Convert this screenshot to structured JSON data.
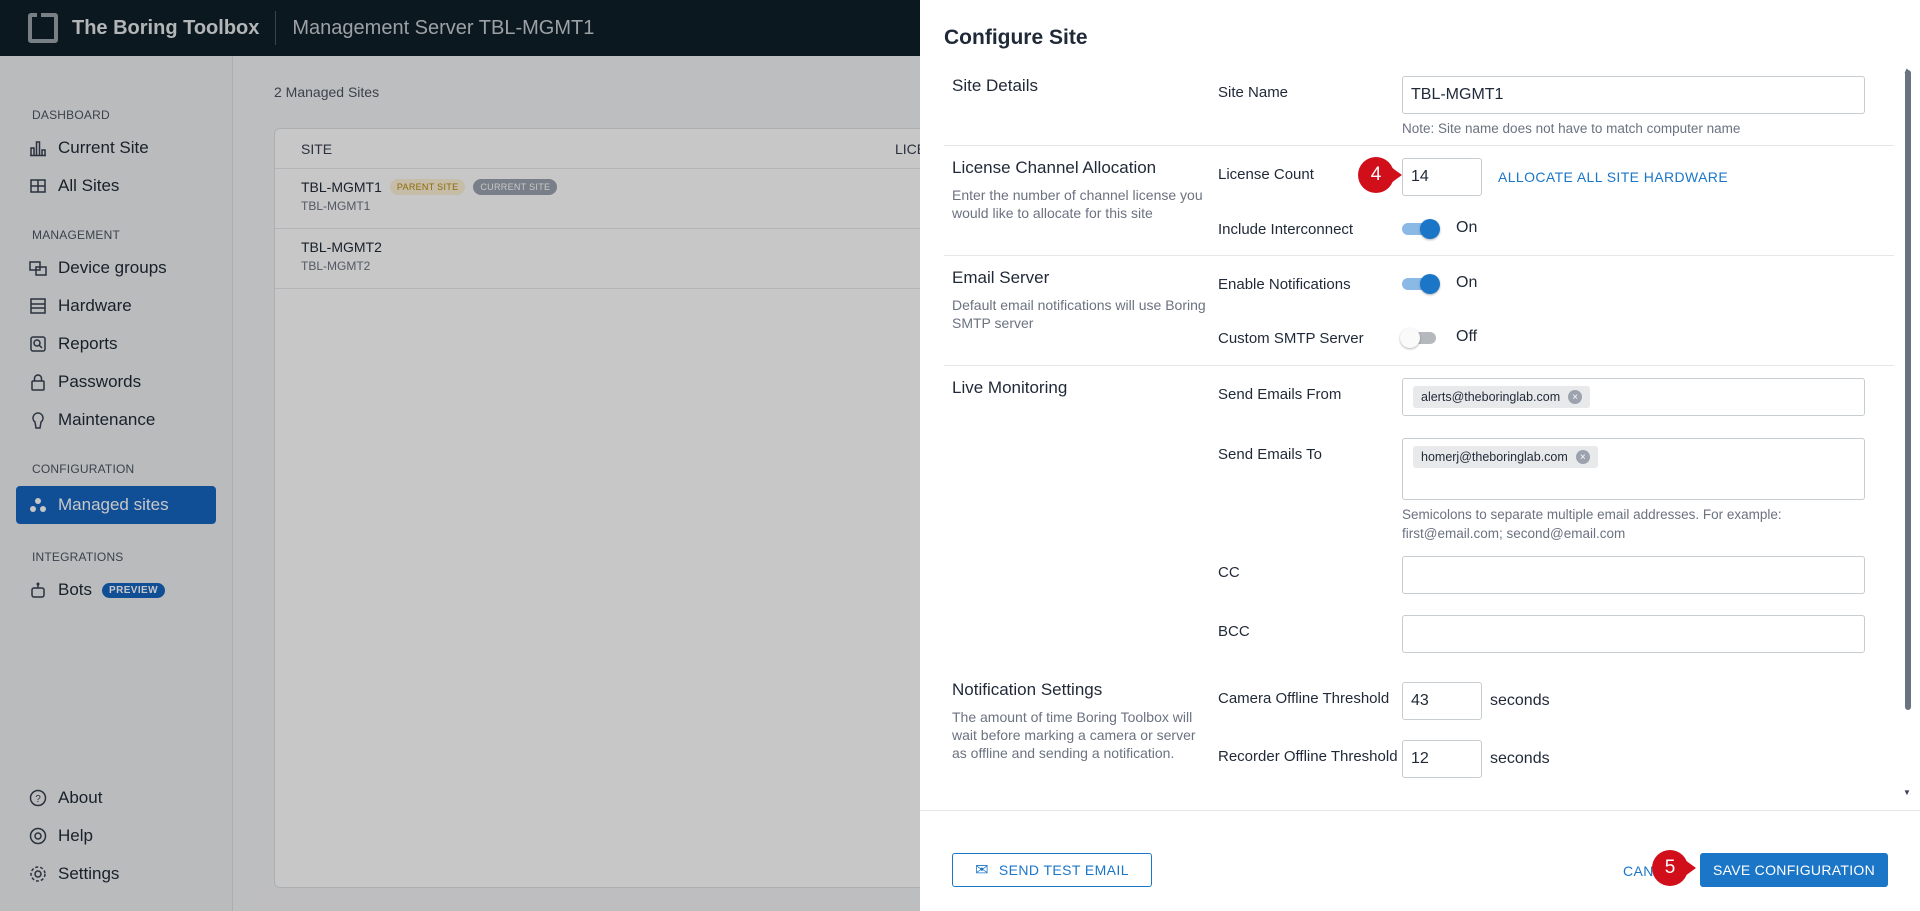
{
  "app": {
    "title": "The Boring Toolbox",
    "server_title": "Management Server TBL-MGMT1"
  },
  "sidebar": {
    "sections": [
      "DASHBOARD",
      "MANAGEMENT",
      "CONFIGURATION",
      "INTEGRATIONS"
    ],
    "items": [
      {
        "label": "Current Site",
        "icon": "bar-chart-icon"
      },
      {
        "label": "All Sites",
        "icon": "grid-icon"
      },
      {
        "label": "Device groups",
        "icon": "device-groups-icon"
      },
      {
        "label": "Hardware",
        "icon": "hardware-icon"
      },
      {
        "label": "Reports",
        "icon": "reports-icon"
      },
      {
        "label": "Passwords",
        "icon": "lock-icon"
      },
      {
        "label": "Maintenance",
        "icon": "maintenance-icon"
      },
      {
        "label": "Managed sites",
        "icon": "managed-sites-icon"
      },
      {
        "label": "Bots",
        "icon": "bot-icon",
        "badge": "PREVIEW"
      }
    ],
    "bottom": [
      {
        "label": "About",
        "icon": "help-circle-icon"
      },
      {
        "label": "Help",
        "icon": "lifebuoy-icon"
      },
      {
        "label": "Settings",
        "icon": "gear-icon"
      }
    ]
  },
  "main": {
    "count": "2 Managed Sites",
    "headers": [
      "SITE",
      "LICEN"
    ],
    "rows": [
      {
        "name": "TBL-MGMT1",
        "sub": "TBL-MGMT1",
        "badges": [
          "PARENT SITE",
          "CURRENT SITE"
        ]
      },
      {
        "name": "TBL-MGMT2",
        "sub": "TBL-MGMT2"
      }
    ]
  },
  "modal": {
    "title": "Configure Site",
    "site_details": {
      "title": "Site Details",
      "site_name_label": "Site Name",
      "site_name_value": "TBL-MGMT1",
      "site_name_note": "Note: Site name does not have to match computer name"
    },
    "license": {
      "title": "License Channel Allocation",
      "desc": "Enter the number of channel license you would like to allocate for this site",
      "count_label": "License Count",
      "count_value": "14",
      "allocate_label": "ALLOCATE ALL SITE HARDWARE",
      "interconnect_label": "Include Interconnect",
      "interconnect_state": "On"
    },
    "email": {
      "title": "Email Server",
      "desc": "Default email notifications will use Boring SMTP server",
      "enable_label": "Enable Notifications",
      "enable_state": "On",
      "custom_label": "Custom SMTP Server",
      "custom_state": "Off"
    },
    "live": {
      "title": "Live Monitoring",
      "from_label": "Send Emails From",
      "from_chip": "alerts@theboringlab.com",
      "to_label": "Send Emails To",
      "to_chip": "homerj@theboringlab.com",
      "to_note": "Semicolons to separate multiple email addresses. For example: first@email.com; second@email.com",
      "cc_label": "CC",
      "bcc_label": "BCC"
    },
    "notification": {
      "title": "Notification Settings",
      "desc": "The amount of time Boring Toolbox will wait before marking a camera or server as offline and sending a notification.",
      "camera_label": "Camera Offline Threshold",
      "camera_value": "43",
      "recorder_label": "Recorder Offline Threshold",
      "recorder_value": "12",
      "unit": "seconds"
    },
    "footer": {
      "test_email": "SEND TEST EMAIL",
      "cancel": "CAN",
      "save": "SAVE CONFIGURATION"
    }
  },
  "annotations": {
    "step4": "4",
    "step5": "5"
  },
  "colors": {
    "accent": "#1b76c8",
    "topbar": "#0f1f2a",
    "step_marker": "#d10f1b",
    "parent_badge": "#b8860b"
  }
}
